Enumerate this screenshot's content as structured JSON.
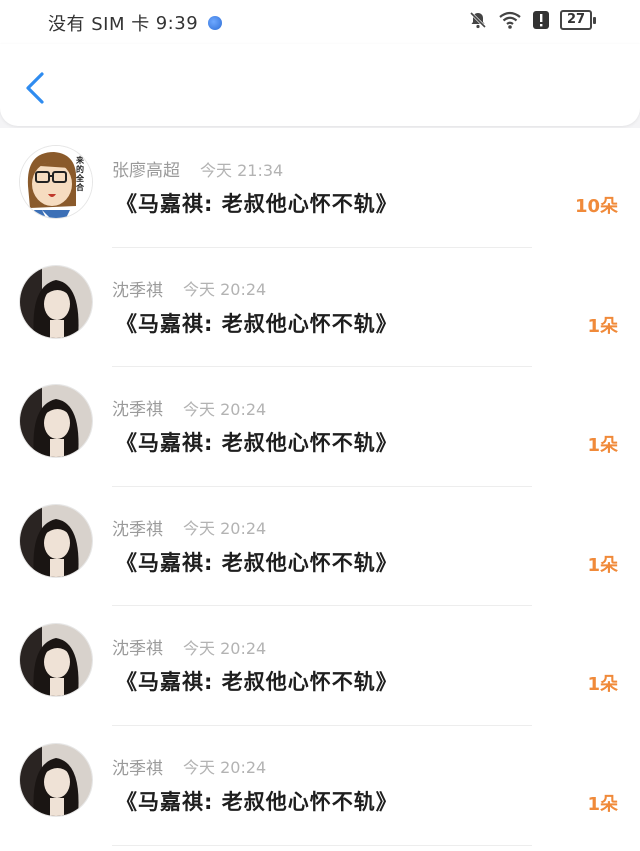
{
  "status_bar": {
    "carrier": "没有 SIM 卡",
    "time": "9:39",
    "battery": "27"
  },
  "header": {
    "back_icon": "chevron-left-icon",
    "accent": "#2f8cf0"
  },
  "items": [
    {
      "name": "张廖高超",
      "time": "今天 21:34",
      "title": "《马嘉祺:  老叔他心怀不轨》",
      "count": "10朵",
      "avatar": "cartoon",
      "avatar_text": "来的全合"
    },
    {
      "name": "沈季祺",
      "time": "今天 20:24",
      "title": "《马嘉祺:  老叔他心怀不轨》",
      "count": "1朵",
      "avatar": "photo"
    },
    {
      "name": "沈季祺",
      "time": "今天 20:24",
      "title": "《马嘉祺:  老叔他心怀不轨》",
      "count": "1朵",
      "avatar": "photo"
    },
    {
      "name": "沈季祺",
      "time": "今天 20:24",
      "title": "《马嘉祺:  老叔他心怀不轨》",
      "count": "1朵",
      "avatar": "photo"
    },
    {
      "name": "沈季祺",
      "time": "今天 20:24",
      "title": "《马嘉祺:  老叔他心怀不轨》",
      "count": "1朵",
      "avatar": "photo"
    },
    {
      "name": "沈季祺",
      "time": "今天 20:24",
      "title": "《马嘉祺:  老叔他心怀不轨》",
      "count": "1朵",
      "avatar": "photo"
    }
  ],
  "colors": {
    "count": "#f08a3a",
    "name": "#9a9a9a",
    "title": "#1e1e1e"
  }
}
